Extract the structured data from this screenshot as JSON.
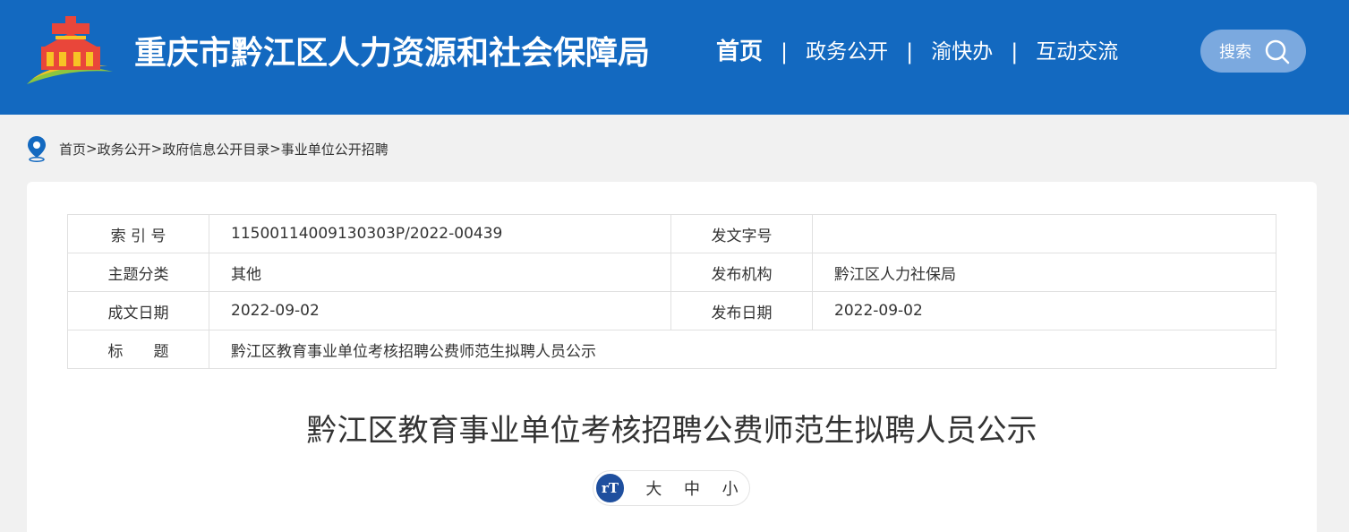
{
  "header": {
    "site_title": "重庆市黔江区人力资源和社会保障局",
    "nav": [
      "首页",
      "政务公开",
      "渝快办",
      "互动交流"
    ],
    "nav_separator": "|",
    "search_label": "搜索"
  },
  "breadcrumb": {
    "items": [
      "首页",
      "政务公开",
      "政府信息公开目录",
      "事业单位公开招聘"
    ],
    "separator": ">"
  },
  "meta": {
    "index_label": "索 引 号",
    "index_value": "11500114009130303P/2022-00439",
    "doc_no_label": "发文字号",
    "doc_no_value": "",
    "topic_label": "主题分类",
    "topic_value": "其他",
    "publisher_label": "发布机构",
    "publisher_value": "黔江区人力社保局",
    "written_date_label": "成文日期",
    "written_date_value": "2022-09-02",
    "publish_date_label": "发布日期",
    "publish_date_value": "2022-09-02",
    "title_label": "标　　题",
    "title_value": "黔江区教育事业单位考核招聘公费师范生拟聘人员公示"
  },
  "article": {
    "title": "黔江区教育事业单位考核招聘公费师范生拟聘人员公示"
  },
  "font_size": {
    "icon_text": "rT",
    "options": [
      "大",
      "中",
      "小"
    ]
  },
  "colors": {
    "header_bg": "#1369c0",
    "search_bg": "#7ba9df",
    "font_icon_bg": "#1f4f9e",
    "page_bg": "#f1f1f1"
  }
}
